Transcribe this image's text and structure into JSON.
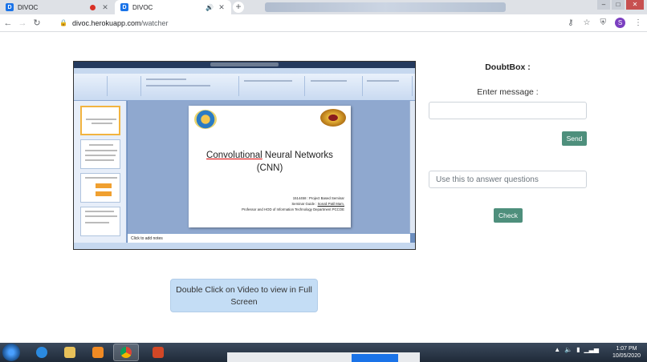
{
  "browser": {
    "tabs": [
      {
        "label": "DIVOC",
        "recording": true
      },
      {
        "label": "DIVOC",
        "active": true
      }
    ],
    "url_host": "divoc.herokuapp.com",
    "url_path": "/watcher",
    "profile_initial": "S"
  },
  "slide": {
    "title_line1_prefix": "Convolutional",
    "title_line1_rest": " Neural Networks",
    "title_line2": "(CNN)",
    "sub_line1": "1514458 : Project Based Seminar",
    "sub_line2_prefix": "Seminar Guide : ",
    "sub_line2_name": "Sonali Patil Mam,",
    "sub_line3": "Professor and HOD of Information Technology Department PCCOE",
    "notes_placeholder": "Click to add notes"
  },
  "video_button": {
    "label": "Double Click on Video to view in Full Screen"
  },
  "doubtbox": {
    "title": "DoubtBox :",
    "enter_label": "Enter message :",
    "message_value": "",
    "send_label": "Send",
    "answer_placeholder": "Use this to answer questions",
    "check_label": "Check"
  },
  "taskbar": {
    "time": "1:07 PM",
    "date": "10/05/2020"
  }
}
